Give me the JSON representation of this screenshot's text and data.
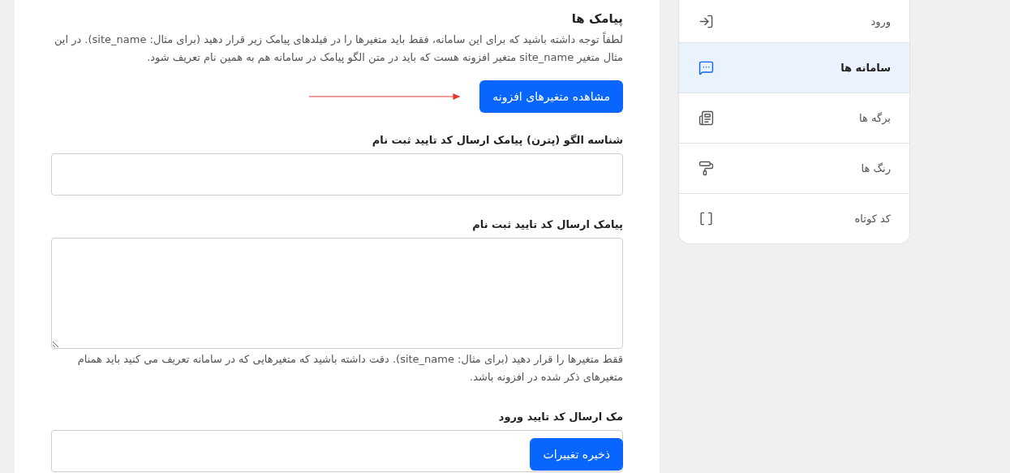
{
  "sidebar": {
    "items": [
      {
        "label": "ورود",
        "kind": "login",
        "selected": false
      },
      {
        "label": "سامانه ها",
        "kind": "message",
        "selected": true
      },
      {
        "label": "برگه ها",
        "kind": "page",
        "selected": false
      },
      {
        "label": "رنگ ها",
        "kind": "roller",
        "selected": false
      },
      {
        "label": "کد کوتاه",
        "kind": "brackets",
        "selected": false
      }
    ]
  },
  "section": {
    "title": "پیامک ها",
    "intro": "لطفاً توجه داشته باشید که برای این سامانه، فقط باید متغیرها را در فیلدهای پیامک زیر قرار دهید (برای مثال: site_name). در این مثال متغیر site_name متغیر افزونه هست که باید در متن الگو پیامک در سامانه هم به همین نام تعریف شود.",
    "variables_button": "مشاهده متغیرهای افزونه"
  },
  "fields": [
    {
      "kind": "input",
      "label": "شناسه الگو (پترن) پیامک ارسال کد تایید ثبت نام"
    },
    {
      "kind": "textarea",
      "label": "پیامک ارسال کد تایید ثبت نام",
      "help": "ققط متغیرها را قرار دهید (برای مثال: site_name). دقت داشته باشید که متغیرهایی که در سامانه تعریف می کنید باید همنام متغیرهای ذکر شده در افزونه باشد."
    },
    {
      "kind": "input",
      "label": "مک ارسال کد تایید ورود"
    }
  ],
  "save_button": "ذخیره تغییرات"
}
